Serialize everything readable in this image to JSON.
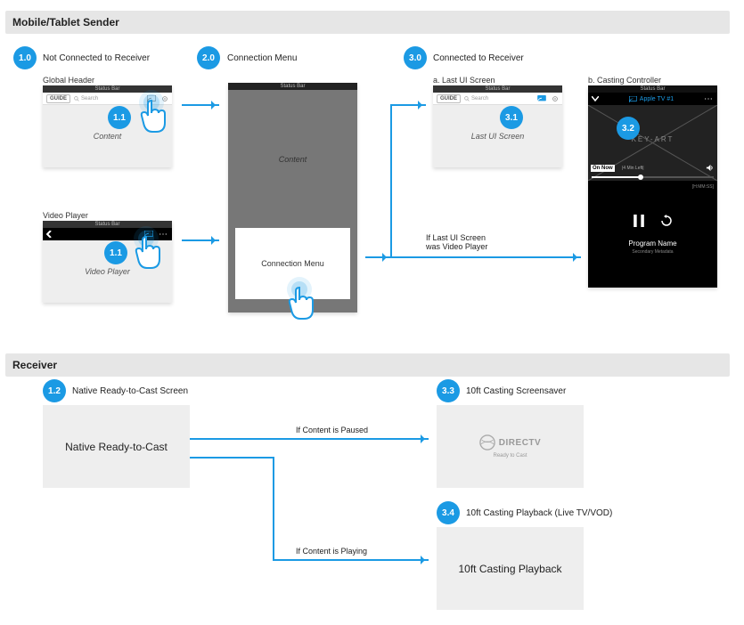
{
  "sections": {
    "sender": "Mobile/Tablet Sender",
    "receiver": "Receiver"
  },
  "nodes": {
    "n1_0": "1.0",
    "n1_0_label": "Not Connected to Receiver",
    "n2_0": "2.0",
    "n2_0_label": "Connection Menu",
    "n3_0": "3.0",
    "n3_0_label": "Connected to Receiver",
    "n1_1": "1.1",
    "n1_2": "1.2",
    "n1_2_label": "Native Ready-to-Cast Screen",
    "n3_1": "3.1",
    "n3_2": "3.2",
    "n3_3": "3.3",
    "n3_3_label": "10ft Casting Screensaver",
    "n3_4": "3.4",
    "n3_4_label": "10ft Casting Playback (Live TV/VOD)"
  },
  "sub": {
    "global_header": "Global Header",
    "video_player": "Video Player",
    "a_last": "a. Last UI Screen",
    "b_cast": "b. Casting Controller"
  },
  "screen": {
    "status_bar": "Status Bar",
    "guide": "GUIDE",
    "search_placeholder": "Search",
    "content": "Content",
    "video_player": "Video Player",
    "last_ui": "Last UI Screen",
    "connection_menu": "Connection Menu",
    "apple_tv": "Apple TV #1",
    "on_now": "On Now",
    "time_left": "|4 Min Left|",
    "key_art": "KEY-ART",
    "program": "Program Name",
    "secondary": "Secondary Metadata",
    "duration": "[H:MM:SS]",
    "native_ready": "Native Ready-to-Cast",
    "playback_10ft": "10ft Casting Playback",
    "directv": "DIRECTV",
    "ready_to_cast": "Ready to Cast"
  },
  "edges": {
    "paused": "If Content is Paused",
    "playing": "If Content is Playing",
    "last_vp": "If Last UI Screen\nwas Video Player"
  },
  "colors": {
    "accent": "#1B9AE4"
  }
}
